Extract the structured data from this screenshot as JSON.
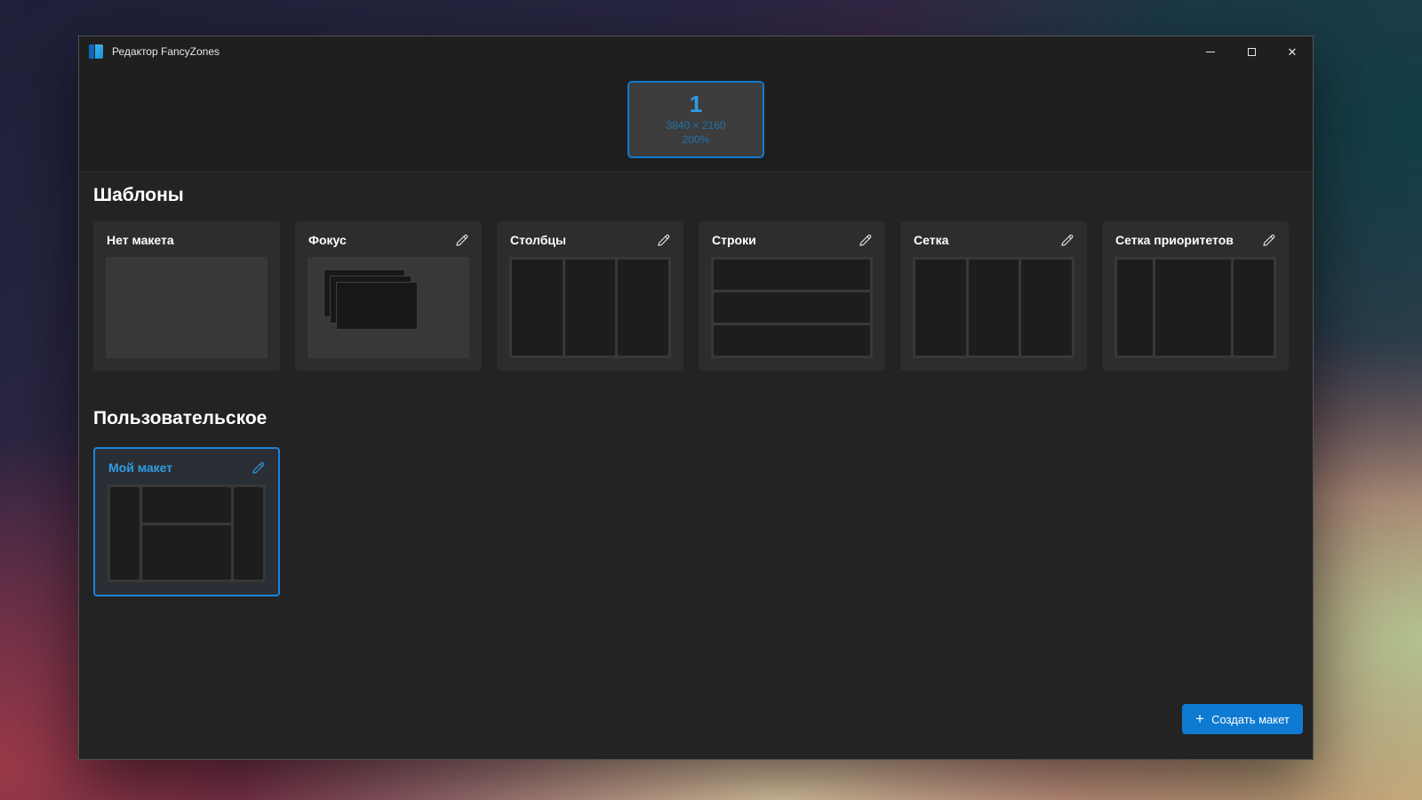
{
  "window": {
    "title": "Редактор FancyZones",
    "controls": {
      "minimize_icon": "minimize-bar",
      "maximize_icon": "maximize-square",
      "close_icon": "✕"
    }
  },
  "monitor": {
    "number": "1",
    "resolution": "3840 × 2160",
    "scaling": "200%"
  },
  "sections": {
    "templates": {
      "heading": "Шаблоны",
      "cards": [
        {
          "label": "Нет макета",
          "type": "blank",
          "editable": false
        },
        {
          "label": "Фокус",
          "type": "focus",
          "editable": true
        },
        {
          "label": "Столбцы",
          "type": "columns",
          "editable": true
        },
        {
          "label": "Строки",
          "type": "rows",
          "editable": true
        },
        {
          "label": "Сетка",
          "type": "grid",
          "editable": true
        },
        {
          "label": "Сетка приоритетов",
          "type": "priority-grid",
          "editable": true
        }
      ]
    },
    "custom": {
      "heading": "Пользовательское",
      "cards": [
        {
          "label": "Мой макет",
          "type": "custom-grid",
          "selected": true,
          "editable": true
        }
      ]
    }
  },
  "footer": {
    "create_button_label": "Создать макет",
    "plus_icon": "+"
  },
  "colors": {
    "accent": "#0f7ad1",
    "selected_text": "#2f9de2",
    "window_bg": "#202020",
    "card_bg": "#2d2d2d"
  }
}
